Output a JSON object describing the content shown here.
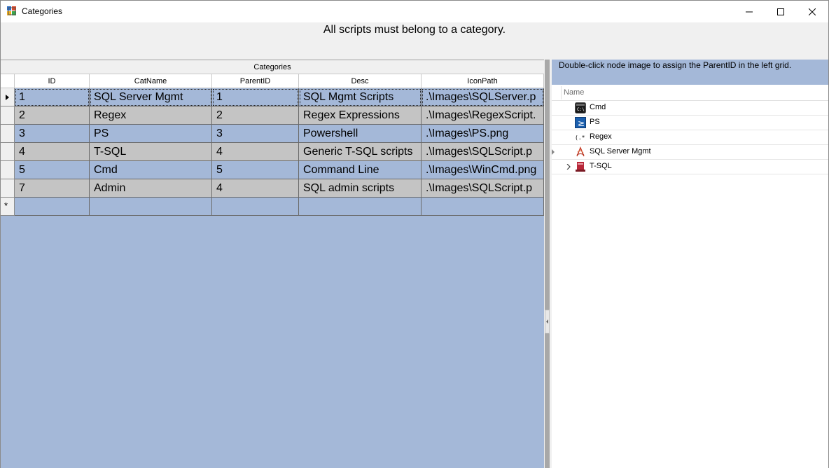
{
  "window": {
    "title": "Categories",
    "app_icon": "categories-app-icon",
    "controls": [
      "minimize",
      "maximize",
      "close"
    ]
  },
  "instruction": "All scripts must belong to a category.",
  "grid": {
    "caption": "Categories",
    "columns": [
      "ID",
      "CatName",
      "ParentID",
      "Desc",
      "IconPath"
    ],
    "rows": [
      {
        "id": "1",
        "catname": "SQL Server Mgmt",
        "parentid": "1",
        "desc": "SQL Mgmt Scripts",
        "iconpath": ".\\Images\\SQLServer.p"
      },
      {
        "id": "2",
        "catname": "Regex",
        "parentid": "2",
        "desc": "Regex Expressions",
        "iconpath": ".\\Images\\RegexScript."
      },
      {
        "id": "3",
        "catname": "PS",
        "parentid": "3",
        "desc": "Powershell",
        "iconpath": ".\\Images\\PS.png"
      },
      {
        "id": "4",
        "catname": "T-SQL",
        "parentid": "4",
        "desc": "Generic T-SQL scripts",
        "iconpath": ".\\Images\\SQLScript.p"
      },
      {
        "id": "5",
        "catname": "Cmd",
        "parentid": "5",
        "desc": "Command Line",
        "iconpath": ".\\Images\\WinCmd.png"
      },
      {
        "id": "7",
        "catname": "Admin",
        "parentid": "4",
        "desc": "SQL admin scripts",
        "iconpath": ".\\Images\\SQLScript.p"
      }
    ],
    "new_row_marker": "*",
    "selected_row": 0,
    "colors": {
      "row_blue": "#a4b8d8",
      "row_gray": "#c4c4c4",
      "background": "#a4b8d8"
    }
  },
  "tree": {
    "instruction": "Double-click node image to assign the ParentID in the left grid.",
    "column_header": "Name",
    "nodes": [
      {
        "label": "Cmd",
        "icon": "cmd-icon",
        "expandable": false
      },
      {
        "label": "PS",
        "icon": "powershell-icon",
        "expandable": false
      },
      {
        "label": "Regex",
        "icon": "regex-icon",
        "expandable": false
      },
      {
        "label": "SQL Server Mgmt",
        "icon": "sql-server-icon",
        "expandable": false
      },
      {
        "label": "T-SQL",
        "icon": "tsql-icon",
        "expandable": true
      }
    ]
  }
}
